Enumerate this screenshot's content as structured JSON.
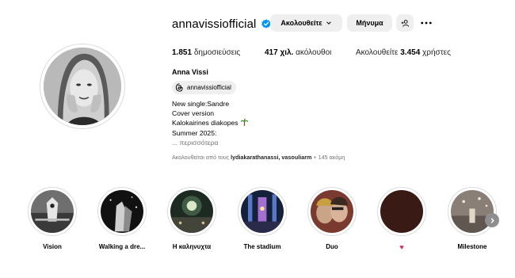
{
  "profile": {
    "username": "annavissiofficial",
    "verified": true,
    "full_name": "Anna Vissi",
    "threads_handle": "annavissiofficial",
    "avatar_description": "black-and-white portrait"
  },
  "actions": {
    "following_label": "Ακολουθείτε",
    "message_label": "Μήνυμα",
    "add_user_icon": "add-user-icon",
    "more_icon": "more-dots-icon"
  },
  "stats": {
    "posts_count": "1.851",
    "posts_label": "δημοσιεύσεις",
    "followers_count": "417 χιλ.",
    "followers_label": "ακόλουθοι",
    "following_prefix": "Ακολουθείτε",
    "following_count": "3.454",
    "following_label": "χρήστες"
  },
  "bio": {
    "lines": [
      "New single:Sandre",
      "Cover version",
      "Kalokairines diakopes",
      "Summer 2025:"
    ],
    "more_label": "... περισσότερα"
  },
  "followed_by": {
    "prefix": "Ακολουθείται από τους",
    "users": "lydiakarathanassi, vasouliarm",
    "suffix": "+ 145 ακόμη"
  },
  "highlights": [
    {
      "label": "Vision"
    },
    {
      "label": "Walking a dre..."
    },
    {
      "label": "Η καληνυχτα"
    },
    {
      "label": "The stadium"
    },
    {
      "label": "Duo"
    },
    {
      "label": "♥"
    },
    {
      "label": "Milestone"
    }
  ],
  "colors": {
    "verified_blue": "#0095f6",
    "button_bg": "#efefef",
    "secondary_text": "#737373",
    "heart_red": "#e0245e"
  }
}
